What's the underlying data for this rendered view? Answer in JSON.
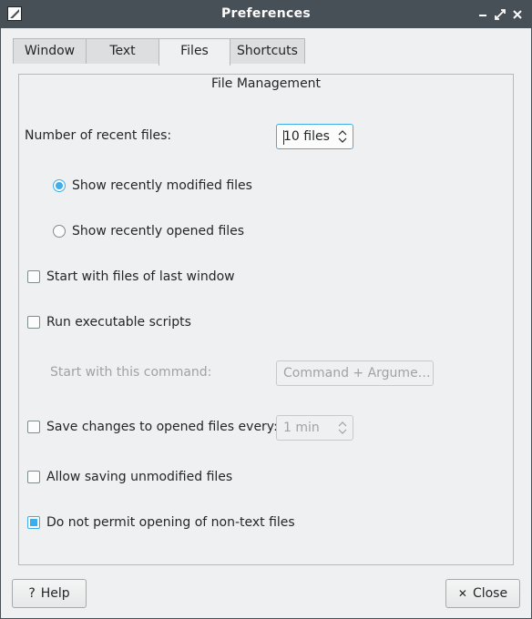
{
  "window": {
    "title": "Preferences"
  },
  "tabs": [
    {
      "label": "Window"
    },
    {
      "label": "Text"
    },
    {
      "label": "Files"
    },
    {
      "label": "Shortcuts"
    }
  ],
  "panel": {
    "title": "File Management",
    "recent_files": {
      "label": "Number of recent files:",
      "value": "10 files"
    },
    "radio_modified": {
      "label": "Show recently modified files",
      "checked": true
    },
    "radio_opened": {
      "label": "Show recently opened files",
      "checked": false
    },
    "start_last_window": {
      "label": "Start with files of last window",
      "checked": false
    },
    "run_scripts": {
      "label": "Run executable scripts",
      "checked": false
    },
    "command": {
      "label": "Start with this command:",
      "placeholder": "Command + Argume…"
    },
    "autosave": {
      "label": "Save changes to opened files every:",
      "checked": false,
      "value": "1 min"
    },
    "save_unmodified": {
      "label": "Allow saving unmodified files",
      "checked": false
    },
    "no_nontext": {
      "label": "Do not permit opening of non-text files",
      "checked": true
    }
  },
  "buttons": {
    "help": "Help",
    "close": "Close",
    "help_glyph": "?",
    "close_glyph": "✕"
  },
  "colors": {
    "titlebar": "#475057",
    "accent": "#3daee9",
    "background": "#eff0f1"
  }
}
